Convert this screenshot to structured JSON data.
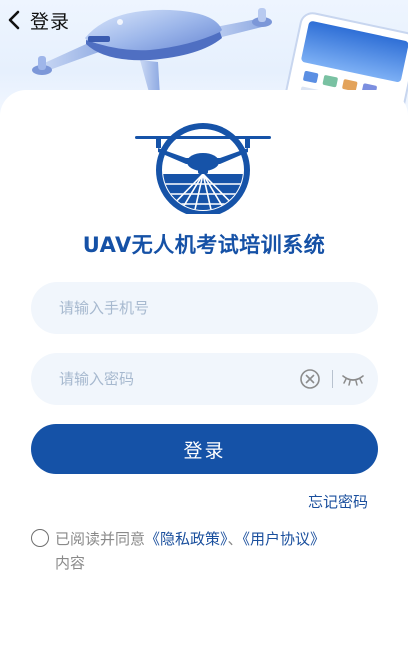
{
  "header": {
    "back_icon": "chevron-left-icon",
    "title": "登录"
  },
  "brand": {
    "logo_icon": "uav-drone-logo-icon",
    "app_title": "UAV无人机考试培训系统"
  },
  "form": {
    "phone_placeholder": "请输入手机号",
    "password_placeholder": "请输入密码",
    "clear_icon": "clear-circle-x-icon",
    "visibility_icon": "eye-closed-icon",
    "login_label": "登录",
    "forgot_label": "忘记密码"
  },
  "agreement": {
    "checked": false,
    "prefix": "已阅读并同意",
    "privacy_label": "《隐私政策》",
    "separator": "、",
    "terms_label": "《用户协议》",
    "suffix": "内容"
  },
  "colors": {
    "primary": "#1552a7",
    "link": "#1a4f9d",
    "input_bg": "#f1f6fc",
    "placeholder": "#a7b9cf"
  }
}
